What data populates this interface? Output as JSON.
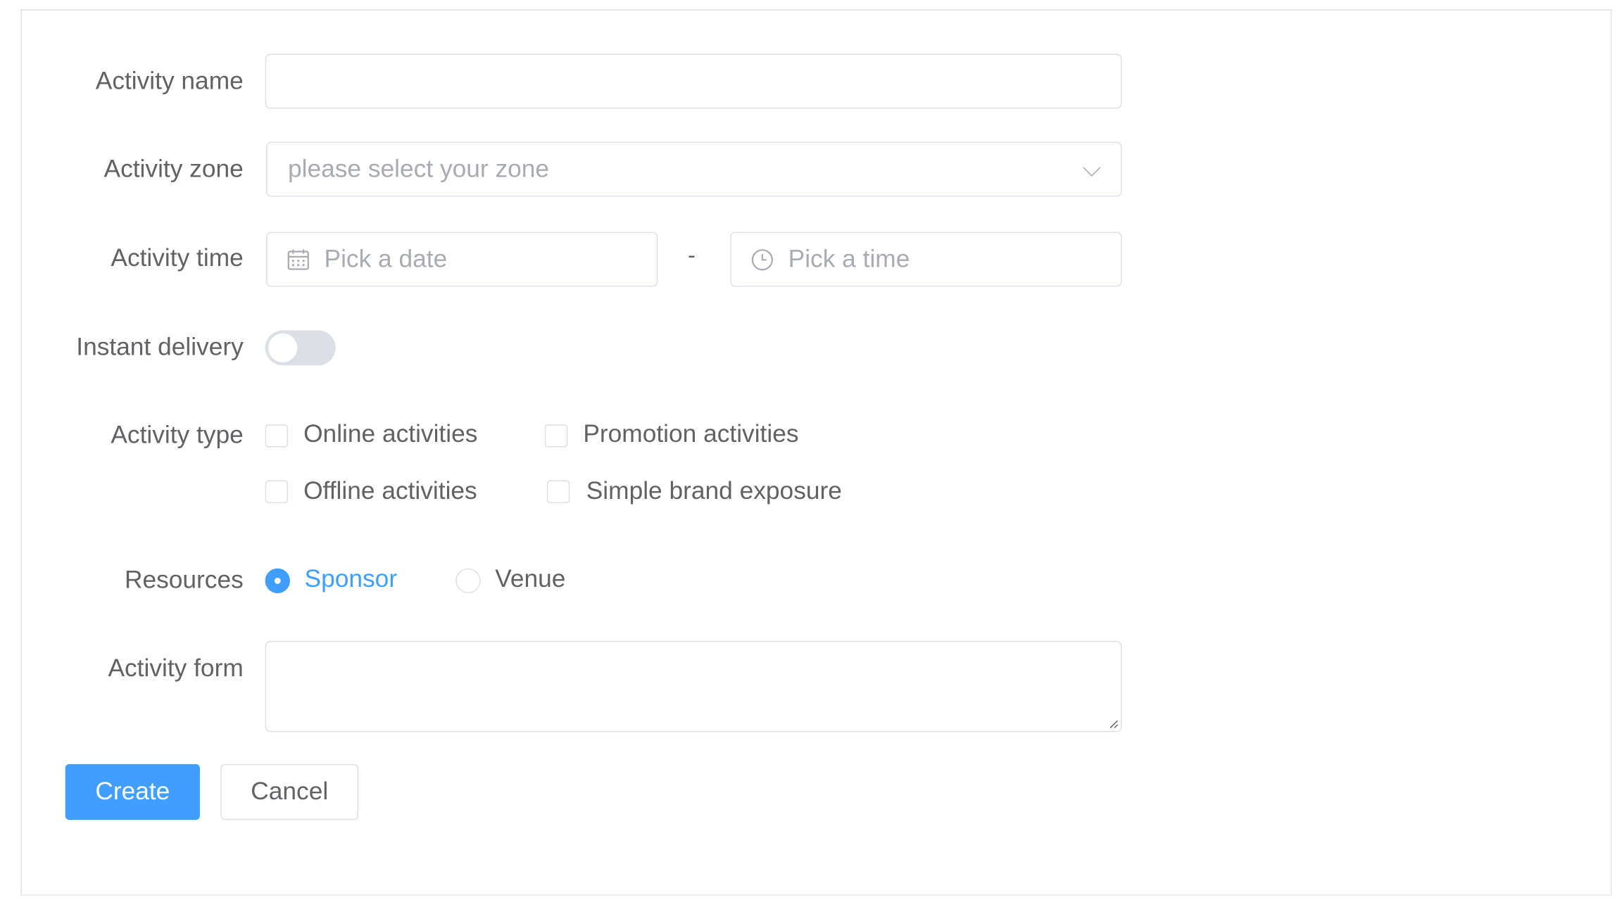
{
  "form": {
    "name": {
      "label": "Activity name",
      "value": ""
    },
    "zone": {
      "label": "Activity zone",
      "placeholder": "please select your zone"
    },
    "time": {
      "label": "Activity time",
      "date_placeholder": "Pick a date",
      "separator": "-",
      "time_placeholder": "Pick a time"
    },
    "delivery": {
      "label": "Instant delivery",
      "enabled": false
    },
    "type": {
      "label": "Activity type",
      "options": [
        {
          "label": "Online activities",
          "checked": false
        },
        {
          "label": "Promotion activities",
          "checked": false
        },
        {
          "label": "Offline activities",
          "checked": false
        },
        {
          "label": "Simple brand exposure",
          "checked": false
        }
      ]
    },
    "resources": {
      "label": "Resources",
      "options": [
        {
          "label": "Sponsor",
          "selected": true
        },
        {
          "label": "Venue",
          "selected": false
        }
      ]
    },
    "form_desc": {
      "label": "Activity form",
      "value": ""
    },
    "buttons": {
      "create": "Create",
      "cancel": "Cancel"
    }
  },
  "colors": {
    "primary": "#409eff",
    "border": "#dcdfe6",
    "placeholder": "#a8abb2",
    "text": "#606266"
  }
}
